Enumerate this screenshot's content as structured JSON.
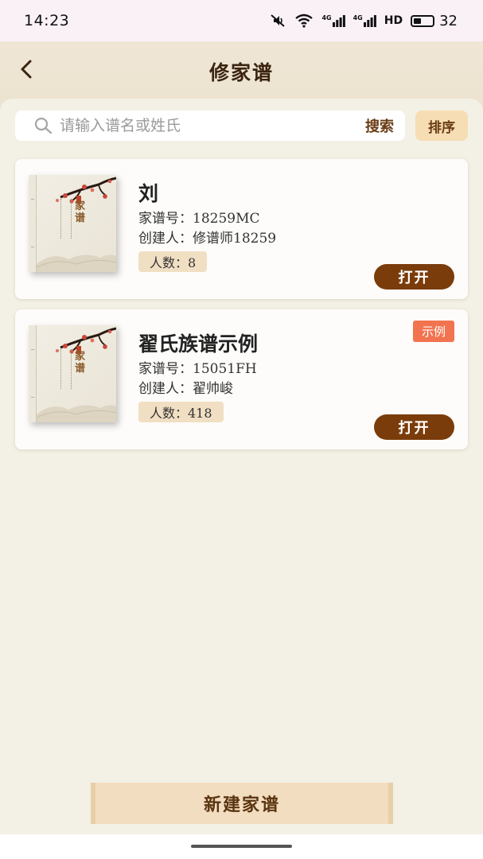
{
  "status_bar": {
    "time": "14:23",
    "net_label_1": "4G",
    "net_label_2": "4G",
    "hd_label": "HD",
    "battery_level": "32"
  },
  "header": {
    "title": "修家谱",
    "back_icon": "chevron-left-icon"
  },
  "search": {
    "placeholder": "请输入谱名或姓氏",
    "value": "",
    "search_label": "搜索",
    "sort_label": "排序"
  },
  "cover": {
    "title_text": "家谱"
  },
  "cards": [
    {
      "name": "刘",
      "genealogy_no": "家谱号：18259MC",
      "creator": "创建人：修谱师18259",
      "member_count": "人数：8",
      "open_label": "打开",
      "tag": ""
    },
    {
      "name": "翟氏族谱示例",
      "genealogy_no": "家谱号：15051FH",
      "creator": "创建人：翟帅峻",
      "member_count": "人数：418",
      "open_label": "打开",
      "tag": "示例"
    }
  ],
  "footer": {
    "new_button_label": "新建家谱"
  },
  "colors": {
    "accent_brown": "#7a3c0b",
    "tag_orange": "#f2734f",
    "badge_beige": "#f1dfc3",
    "sort_bg": "#f7ddb3"
  }
}
